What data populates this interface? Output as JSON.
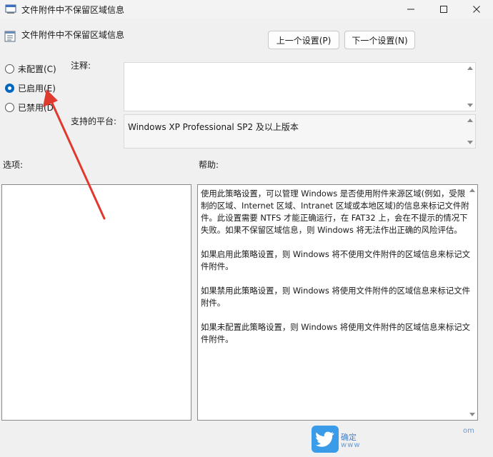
{
  "window": {
    "title": "文件附件中不保留区域信息",
    "controls": {
      "minimize": "─",
      "maximize": "☐",
      "close": "✕"
    }
  },
  "header": {
    "title": "文件附件中不保留区域信息",
    "prev_button": "上一个设置(P)",
    "next_button": "下一个设置(N)"
  },
  "radios": [
    {
      "label": "未配置(C)",
      "checked": false
    },
    {
      "label": "已启用(E)",
      "checked": true
    },
    {
      "label": "已禁用(D",
      "checked": false
    }
  ],
  "comment": {
    "label": "注释:",
    "value": ""
  },
  "platform": {
    "label": "支持的平台:",
    "value": "Windows XP Professional SP2 及以上版本"
  },
  "options": {
    "label": "选项:"
  },
  "help": {
    "label": "帮助:",
    "paragraphs": [
      "使用此策略设置，可以管理 Windows 是否使用附件来源区域(例如，受限制的区域、Internet 区域、Intranet 区域或本地区域)的信息来标记文件附件。此设置需要 NTFS 才能正确运行，在 FAT32 上，会在不提示的情况下失败。如果不保留区域信息，则 Windows 将无法作出正确的风险评估。",
      "如果启用此策略设置，则 Windows 将不使用文件附件的区域信息来标记文件附件。",
      "如果禁用此策略设置，则 Windows 将使用文件附件的区域信息来标记文件附件。",
      "如果未配置此策略设置，则 Windows 将使用文件附件的区域信息来标记文件附件。"
    ]
  },
  "watermark": {
    "text": "确定",
    "sub": "www",
    "edge": "om"
  },
  "colors": {
    "accent": "#0067c0",
    "arrow": "#e03a2f",
    "background": "#f0f0f0"
  },
  "icons": {
    "title": "policy-window-icon",
    "header": "policy-setting-icon",
    "watermark": "bird-logo-icon"
  }
}
